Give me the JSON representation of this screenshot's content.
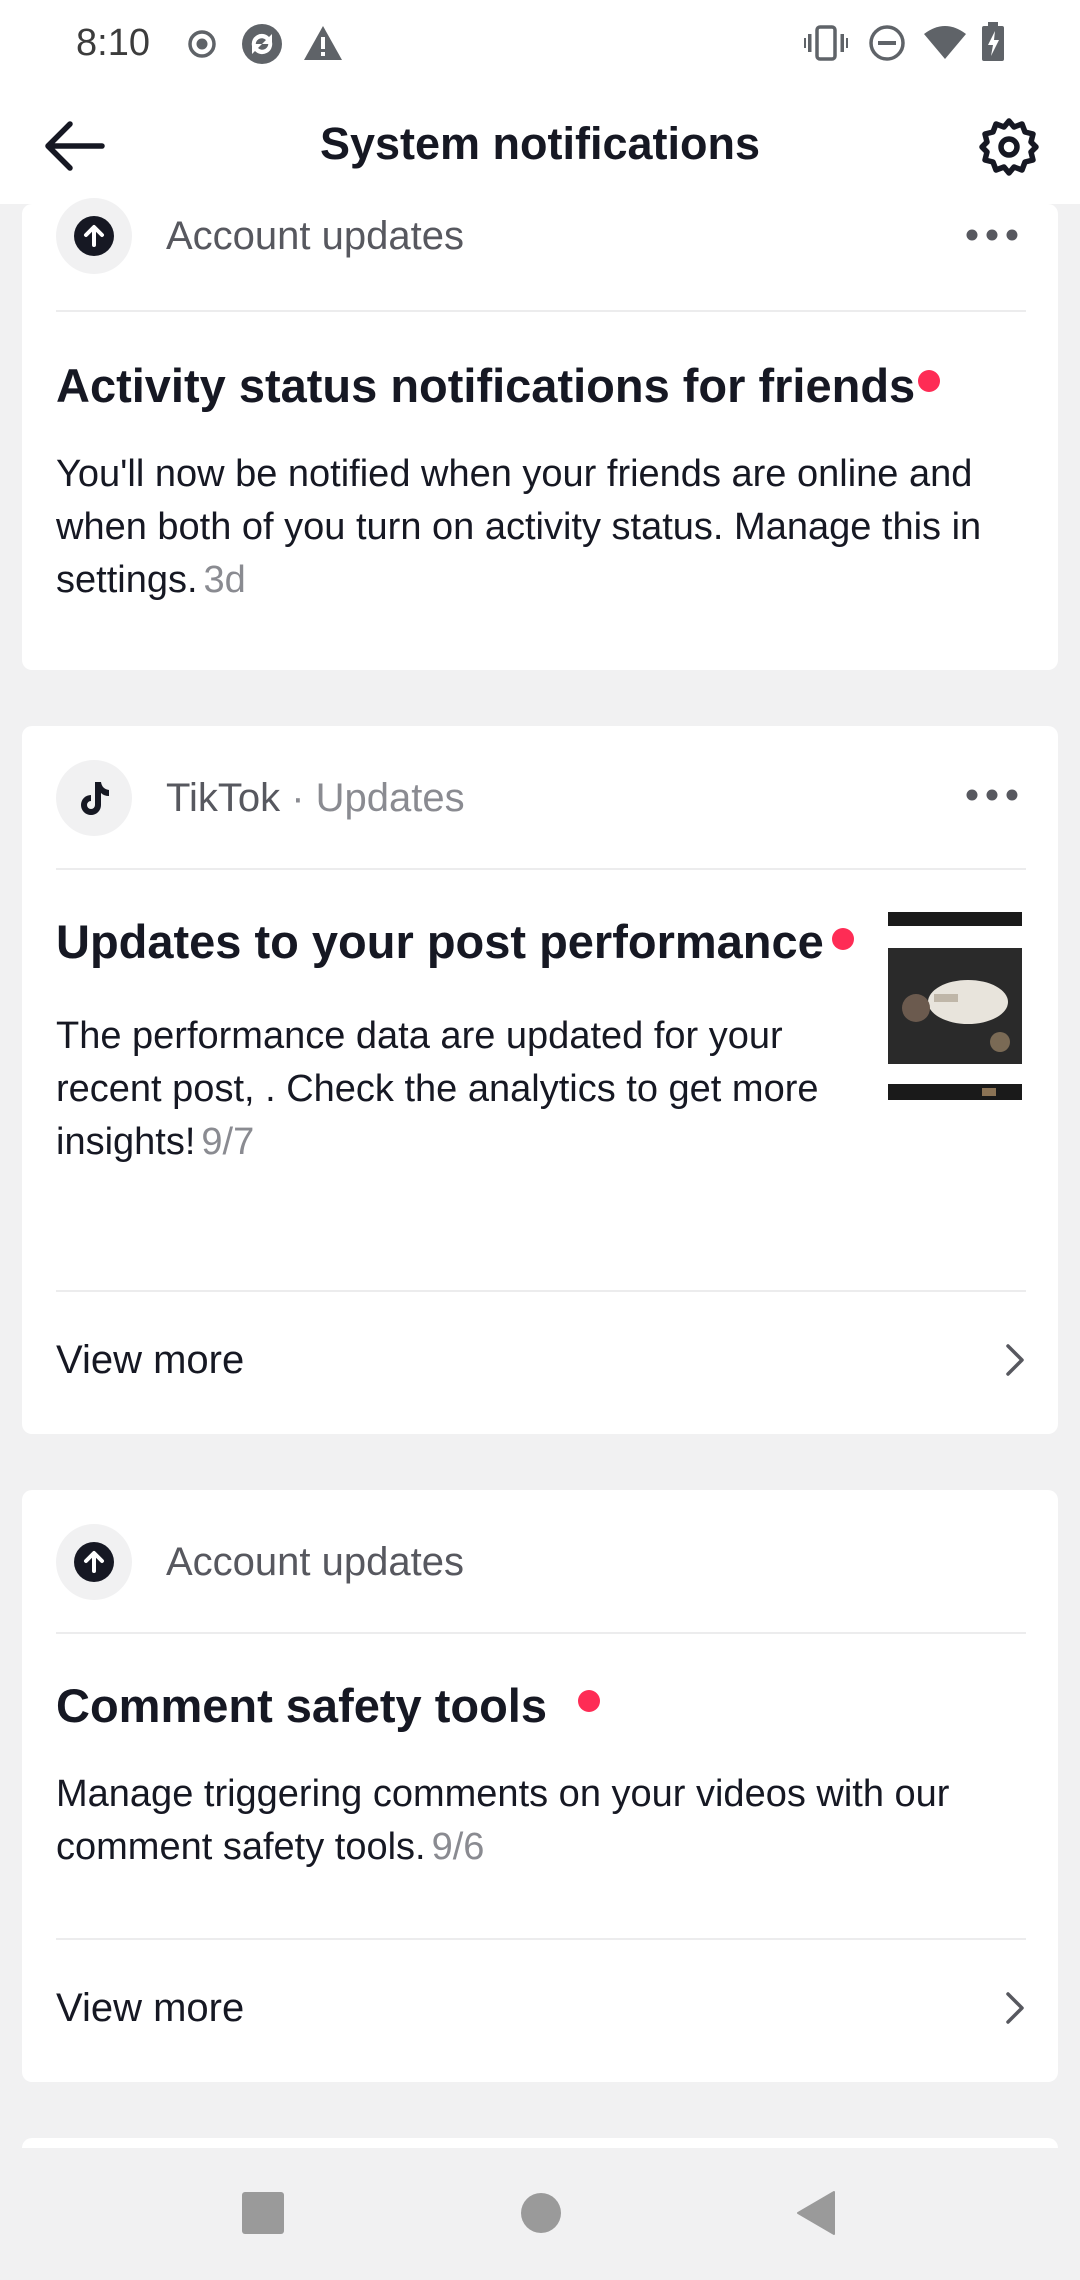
{
  "status_bar": {
    "time": "8:10",
    "left_icons": [
      "radio-button-icon",
      "sync-icon",
      "warning-icon"
    ],
    "right_icons": [
      "vibrate-icon",
      "do-not-disturb-icon",
      "wifi-icon",
      "battery-charging-icon"
    ]
  },
  "header": {
    "title": "System notifications",
    "back_icon": "arrow-left-icon",
    "settings_icon": "gear-icon"
  },
  "cards": [
    {
      "source": "Account updates",
      "icon": "arrow-up-circle-icon",
      "title": "Activity status notifications for friends",
      "body": "You'll now be notified when your friends are online and when both of you turn on activity status. Manage this in settings.",
      "timestamp": "3d",
      "unread": true
    },
    {
      "source": "TikTok",
      "separator": "·",
      "source_sub": "Updates",
      "icon": "tiktok-logo-icon",
      "title": "Updates to your post performance",
      "body": "The performance data are updated for your recent post, . Check the analytics to get more insights!",
      "timestamp": "9/7",
      "unread": true,
      "view_more": "View more"
    },
    {
      "source": "Account updates",
      "icon": "arrow-up-circle-icon",
      "title": "Comment safety tools",
      "body": "Manage triggering comments on your videos with our comment safety tools.",
      "timestamp": "9/6",
      "unread": true,
      "view_more": "View more"
    }
  ],
  "nav_bar": {
    "buttons": [
      "recents-square-icon",
      "home-circle-icon",
      "back-triangle-icon"
    ]
  },
  "colors": {
    "accent_unread": "#fe2c55",
    "background": "#f1f1f2",
    "card": "#ffffff"
  }
}
